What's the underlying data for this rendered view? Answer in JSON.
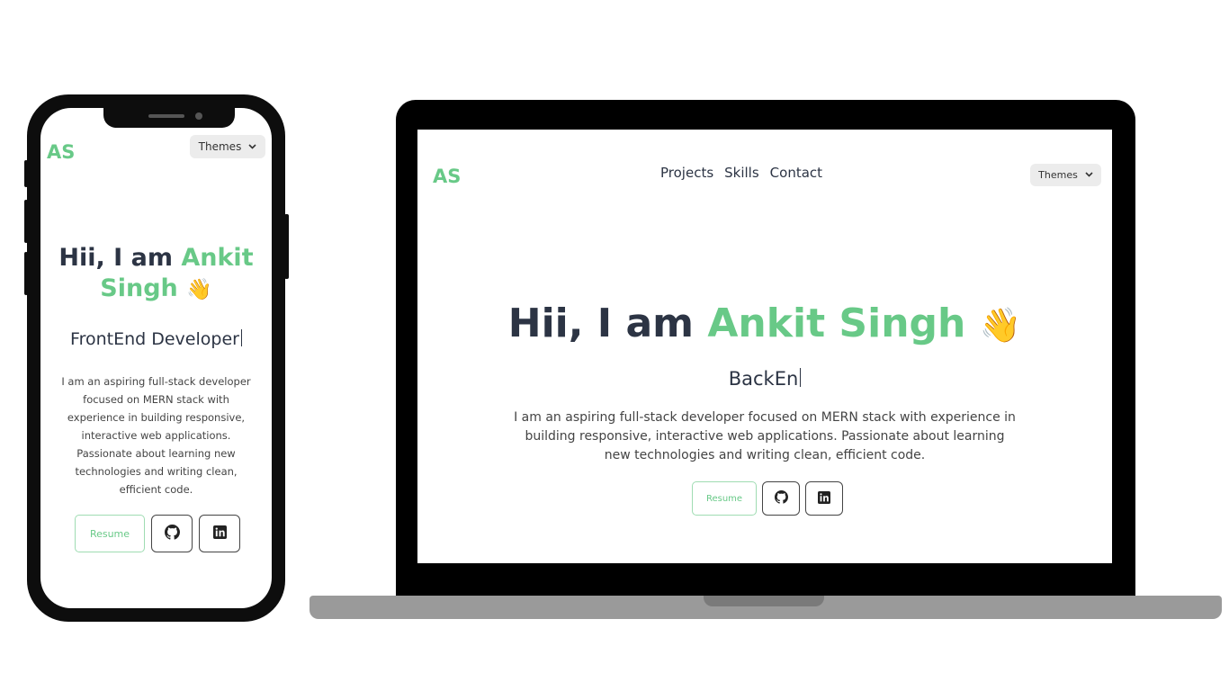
{
  "mobile": {
    "logo": "AS",
    "themes_label": "Themes",
    "hero": {
      "greeting": "Hii, I am",
      "name": "Ankit Singh",
      "emoji": "👋",
      "role_typed": "FrontEnd Developer",
      "description": "I am an aspiring full-stack developer focused on MERN stack with experience in building responsive, interactive web applications. Passionate about learning new technologies and writing clean, efficient code.",
      "resume_label": "Resume"
    }
  },
  "desktop": {
    "logo": "AS",
    "nav": [
      "Projects",
      "Skills",
      "Contact"
    ],
    "themes_label": "Themes",
    "hero": {
      "greeting": "Hii, I am",
      "name": "Ankit Singh",
      "emoji": "👋",
      "role_typed": "BackEn",
      "description": "I am an aspiring full-stack developer focused on MERN stack with experience in building responsive, interactive web applications. Passionate about learning new technologies and writing clean, efficient code.",
      "resume_label": "Resume"
    }
  },
  "icons": {
    "github": "github-icon",
    "linkedin": "linkedin-icon",
    "chevron": "chevron-down-icon"
  },
  "colors": {
    "accent": "#68c987",
    "text": "#2c3444"
  }
}
